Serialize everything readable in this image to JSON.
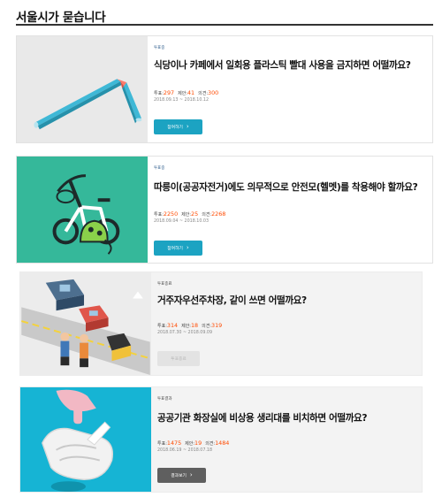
{
  "page": {
    "title": "서울시가 묻습니다"
  },
  "labels": {
    "votes": "투표:",
    "proposals": "제안:",
    "opinions": "의견:"
  },
  "cards": [
    {
      "status": "투표중",
      "title": "식당이나 카페에서 일회용 플라스틱 빨대 사용을 금지하면 어떨까요?",
      "votes": "297",
      "proposals": "41",
      "opinions": "300",
      "period": "2018.09.13 ~ 2018.10.12",
      "button": "참여하기",
      "button_icon": "chevron-right-icon"
    },
    {
      "status": "투표중",
      "title": "따릉이(공공자전거)에도 의무적으로 안전모(헬멧)를 착용해야 할까요?",
      "votes": "2250",
      "proposals": "25",
      "opinions": "2268",
      "period": "2018.09.04 ~ 2018.10.03",
      "button": "참여하기",
      "button_icon": "chevron-right-icon"
    },
    {
      "status": "투표종료",
      "title": "거주자우선주차장, 같이 쓰면 어떨까요?",
      "votes": "314",
      "proposals": "18",
      "opinions": "319",
      "period": "2018.07.30 ~ 2018.09.09",
      "button": "투표종료"
    },
    {
      "status": "투표결과",
      "title": "공공기관 화장실에 비상용 생리대를 비치하면 어떨까요?",
      "votes": "1475",
      "proposals": "19",
      "opinions": "1484",
      "period": "2018.06.19 ~ 2018.07.18",
      "button": "결과보기",
      "button_icon": "chevron-right-icon"
    }
  ],
  "colors": {
    "accent": "#1ca3c2",
    "count": "#ff4a00",
    "result_button": "#5f5f5f",
    "bike_thumb_bg": "#35b89a",
    "pad_thumb_bg": "#16b4d4"
  }
}
